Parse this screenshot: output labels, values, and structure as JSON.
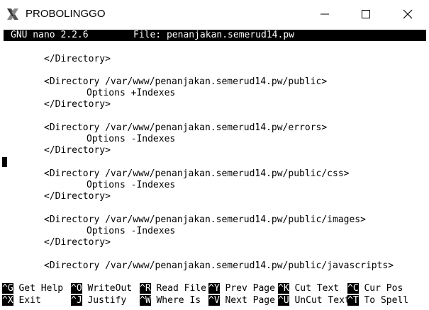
{
  "window": {
    "title": "PROBOLINGGO"
  },
  "nano": {
    "version": "GNU nano 2.2.6",
    "file_label": "File: penanjakan.semerud14.pw"
  },
  "lines": [
    "</Directory>",
    "<Directory /var/www/penanjakan.semerud14.pw/public>",
    "Options +Indexes",
    "</Directory>",
    "<Directory /var/www/penanjakan.semerud14.pw/errors>",
    "Options -Indexes",
    "</Directory>",
    "<Directory /var/www/penanjakan.semerud14.pw/public/css>",
    "Options -Indexes",
    "</Directory>",
    "<Directory /var/www/penanjakan.semerud14.pw/public/images>",
    "Options -Indexes",
    "</Directory>",
    "<Directory /var/www/penanjakan.semerud14.pw/public/javascripts>"
  ],
  "shortcuts": [
    {
      "key": "^G",
      "label": "Get Help"
    },
    {
      "key": "^O",
      "label": "WriteOut"
    },
    {
      "key": "^R",
      "label": "Read File"
    },
    {
      "key": "^Y",
      "label": "Prev Page"
    },
    {
      "key": "^K",
      "label": "Cut Text"
    },
    {
      "key": "^C",
      "label": "Cur Pos"
    },
    {
      "key": "^X",
      "label": "Exit"
    },
    {
      "key": "^J",
      "label": "Justify"
    },
    {
      "key": "^W",
      "label": "Where Is"
    },
    {
      "key": "^V",
      "label": "Next Page"
    },
    {
      "key": "^U",
      "label": "UnCut Text"
    },
    {
      "key": "^T",
      "label": "To Spell"
    }
  ]
}
